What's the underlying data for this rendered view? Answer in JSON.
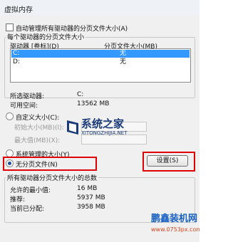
{
  "window": {
    "title": "虚拟内存"
  },
  "auto_manage": {
    "label": "自动管理所有驱动器的分页文件大小(A)",
    "checked": false
  },
  "drives_group": {
    "legend": "每个驱动器的分页文件大小",
    "col_drive": "驱动器 [卷标](D)",
    "col_size": "分页文件大小(MB)",
    "rows": [
      {
        "drive": "C:",
        "size": "无",
        "selected": true
      },
      {
        "drive": "D:",
        "size": "无",
        "selected": false
      }
    ]
  },
  "info": {
    "selected_label": "所选驱动器:",
    "selected_value": "C:",
    "free_label": "可用空间:",
    "free_value": "13562 MB"
  },
  "custom": {
    "radio_label": "自定义大小(C):",
    "initial_label": "初始大小(MB)(I):",
    "max_label": "最大值(MB)(X):"
  },
  "system_managed": {
    "label": "系统管理的大小(Y)"
  },
  "no_paging": {
    "label": "无分页文件(N)"
  },
  "set_button": {
    "label": "设置(S)"
  },
  "totals": {
    "legend": "所有驱动器分页文件大小的总数",
    "min_label": "允许的最小值:",
    "min_value": "16 MB",
    "rec_label": "推荐:",
    "rec_value": "5937 MB",
    "cur_label": "当前已分配:",
    "cur_value": "3958 MB"
  },
  "watermark": {
    "cn": "系统之家",
    "en": "XITONGZHIJIA.NET"
  },
  "brand": {
    "cn": "鹏鑫装机网",
    "url": "www.0753px.com"
  },
  "colors": {
    "selection": "#3399ff",
    "highlight_box": "#e00000"
  }
}
